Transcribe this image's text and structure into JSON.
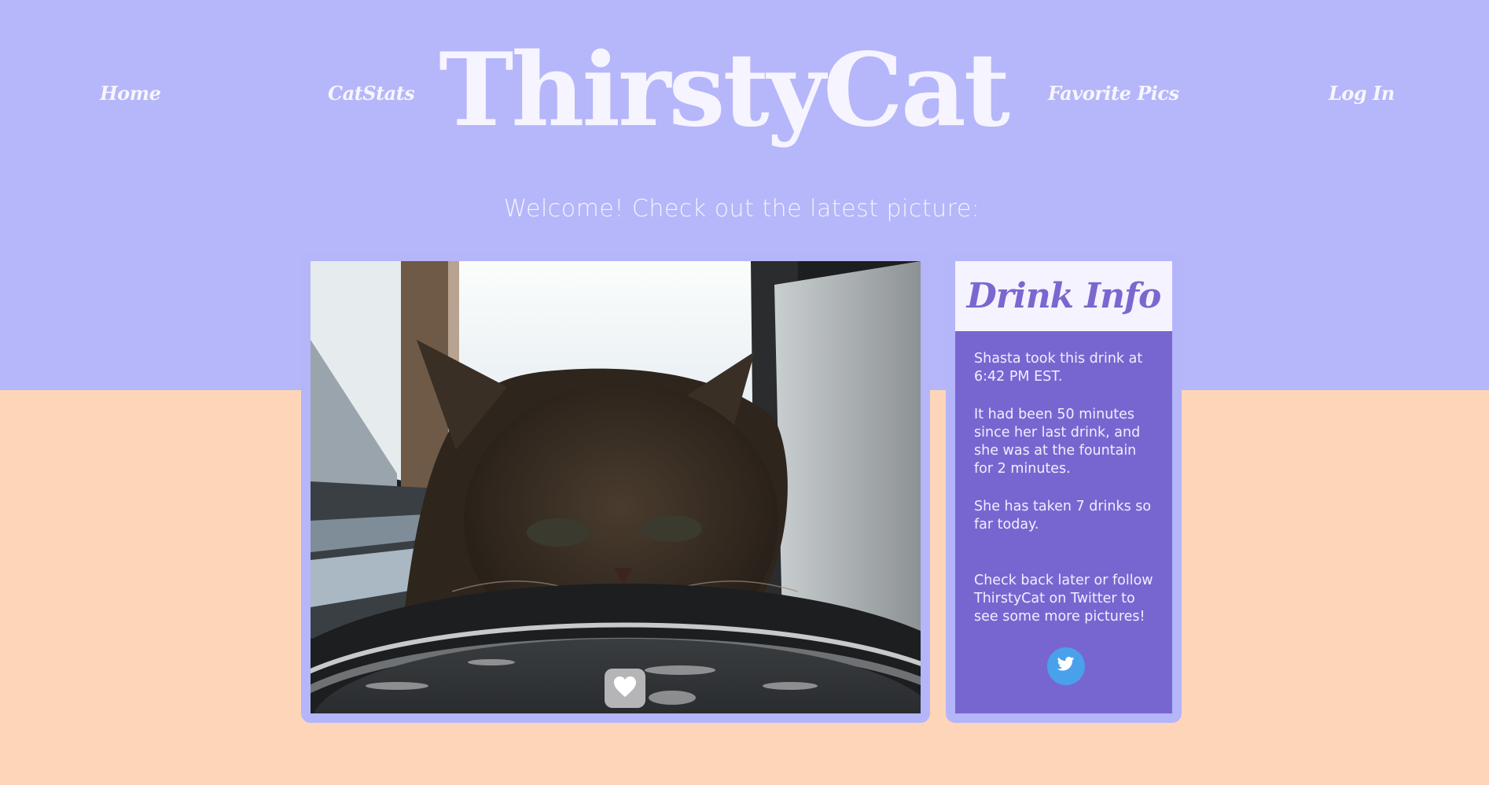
{
  "nav": {
    "home": "Home",
    "catstats": "CatStats",
    "favorite_pics": "Favorite Pics",
    "login": "Log In"
  },
  "site_title": "ThirstyCat",
  "welcome": "Welcome! Check out the latest picture:",
  "photo": {
    "like_icon": "heart-icon"
  },
  "drink_info": {
    "title": "Drink Info",
    "time_text": "Shasta took this drink at 6:42 PM EST.",
    "interval_text": "It had been 50 minutes since her last drink, and she was at the fountain for 2 minutes.",
    "count_text": "She has taken 7 drinks so far today.",
    "followup_text": "Check back later or follow ThirstyCat on Twitter to see some more pictures!",
    "twitter_icon": "twitter-bird-icon"
  },
  "colors": {
    "header_bg": "#b6b6fa",
    "page_bg": "#fed5b9",
    "info_panel": "#7866d0",
    "accent_text": "#7b67cf",
    "twitter": "#4aa1eb"
  }
}
